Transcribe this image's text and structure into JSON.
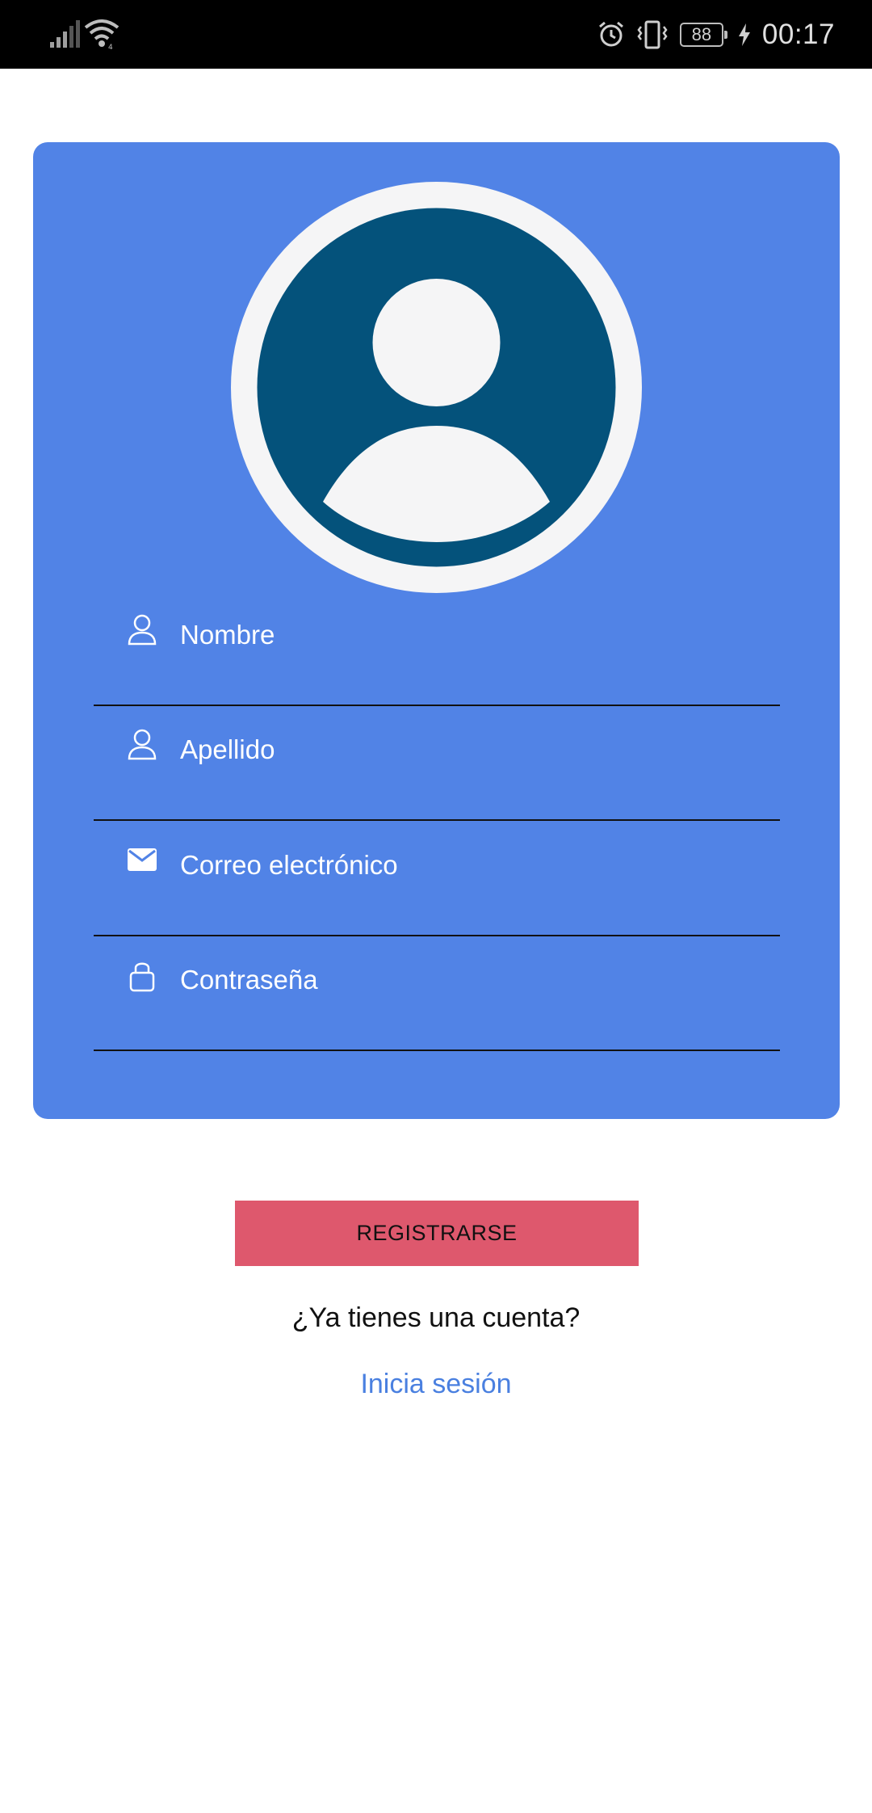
{
  "status_bar": {
    "battery": "88",
    "time": "00:17",
    "icons": [
      "signal-icon",
      "wifi-icon",
      "alarm-icon",
      "vibrate-icon",
      "battery-icon",
      "charging-icon"
    ]
  },
  "form": {
    "avatar_icon": "user-avatar-icon",
    "fields": [
      {
        "placeholder": "Nombre",
        "icon": "person-icon"
      },
      {
        "placeholder": "Apellido",
        "icon": "person-icon"
      },
      {
        "placeholder": "Correo electrónico",
        "icon": "mail-icon"
      },
      {
        "placeholder": "Contraseña",
        "icon": "lock-icon"
      }
    ]
  },
  "actions": {
    "register_label": "REGISTRARSE",
    "account_prompt": "¿Ya tienes una cuenta?",
    "login_link": "Inicia sesión"
  },
  "colors": {
    "card": "#5183e6",
    "avatar_bg": "#04527b",
    "register_button": "#de586d",
    "link": "#4a80e0"
  }
}
